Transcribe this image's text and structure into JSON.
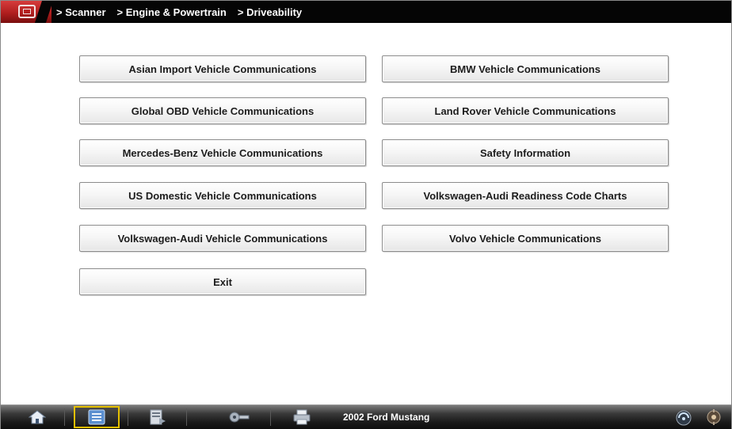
{
  "breadcrumb": {
    "items": [
      "> Scanner",
      "> Engine & Powertrain",
      "> Driveability"
    ]
  },
  "menu": {
    "buttons": [
      "Asian Import Vehicle Communications",
      "BMW Vehicle Communications",
      "Global OBD Vehicle Communications",
      "Land Rover Vehicle Communications",
      "Mercedes-Benz Vehicle Communications",
      "Safety Information",
      "US Domestic Vehicle Communications",
      "Volkswagen-Audi Readiness Code Charts",
      "Volkswagen-Audi Vehicle Communications",
      "Volvo Vehicle Communications",
      "Exit"
    ]
  },
  "taskbar": {
    "vehicle": "2002 Ford Mustang",
    "icons": [
      "home-icon",
      "scanner-icon",
      "data-icon",
      "tools-icon",
      "printer-icon",
      "connection-icon",
      "settings-icon"
    ]
  },
  "colors": {
    "topbar": "#050505",
    "logo": "#c0282a",
    "active_outline": "#e5c000"
  }
}
